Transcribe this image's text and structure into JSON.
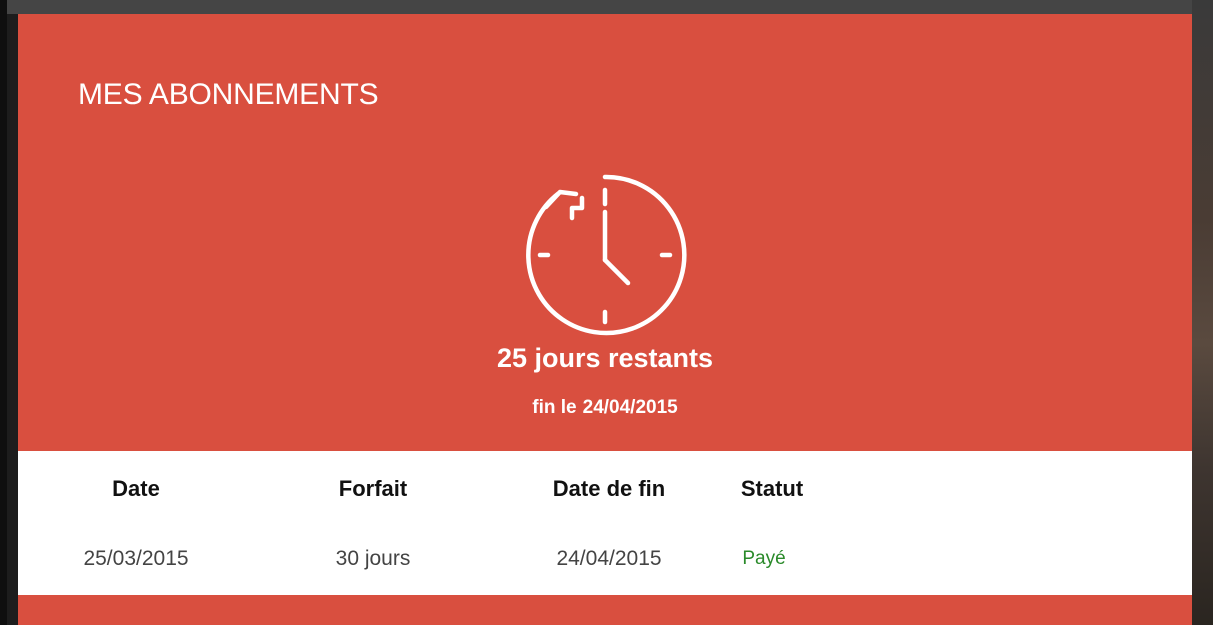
{
  "panel": {
    "title": "MES ABONNEMENTS",
    "icon": "clock-renew-icon",
    "days_remaining": "25 jours restants",
    "end_date_prefix": "fin le",
    "end_date": "24/04/2015"
  },
  "table": {
    "headers": {
      "date": "Date",
      "plan": "Forfait",
      "end_date": "Date de fin",
      "status": "Statut"
    },
    "rows": [
      {
        "date": "25/03/2015",
        "plan": "30 jours",
        "end_date": "24/04/2015",
        "status": "Payé"
      }
    ]
  },
  "colors": {
    "panel_background": "#d94f3f",
    "status_paid": "#2a8a2a"
  }
}
